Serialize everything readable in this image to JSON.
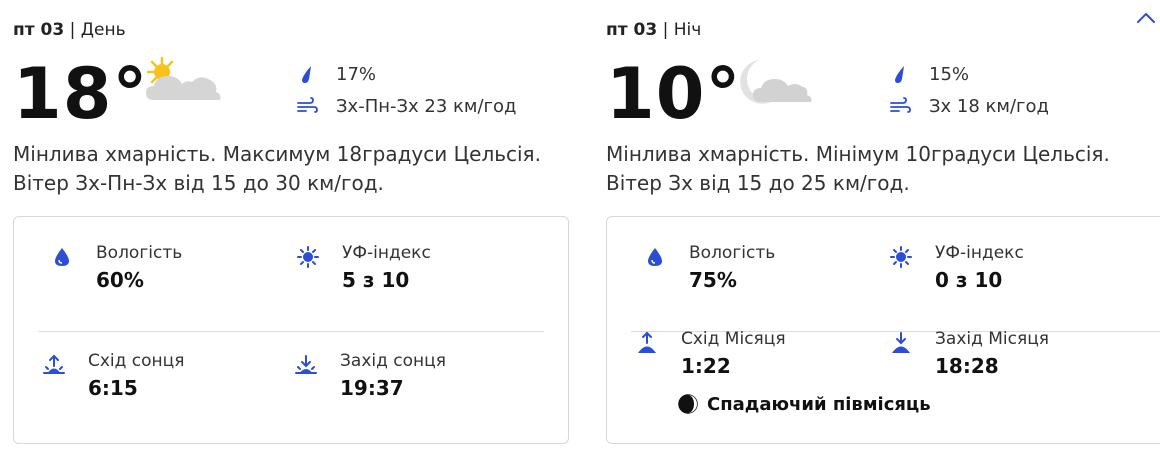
{
  "day": {
    "date": "пт 03",
    "separator": "|",
    "period": "День",
    "temperature": "18°",
    "weather_icon": "partly-sunny-icon",
    "precip": "17%",
    "wind": "Зх-Пн-Зх 23 км/год",
    "description": "Мінлива хмарність. Максимум 18градуси Цельсія. Вітер Зх-Пн-Зх від 15 до 30 км/год.",
    "humidity_label": "Вологість",
    "humidity_value": "60%",
    "uv_label": "УФ-індекс",
    "uv_value": "5 з 10",
    "sunrise_label": "Схід сонця",
    "sunrise_value": "6:15",
    "sunset_label": "Захід сонця",
    "sunset_value": "19:37"
  },
  "night": {
    "date": "пт 03",
    "separator": "|",
    "period": "Ніч",
    "temperature": "10°",
    "weather_icon": "partly-cloudy-night-icon",
    "precip": "15%",
    "wind": "Зх 18 км/год",
    "description": "Мінлива хмарність. Мінімум 10градуси Цельсія. Вітер Зх від 15 до 25 км/год.",
    "humidity_label": "Вологість",
    "humidity_value": "75%",
    "uv_label": "УФ-індекс",
    "uv_value": "0 з 10",
    "moonrise_label": "Схід Місяця",
    "moonrise_value": "1:22",
    "moonset_label": "Захід Місяця",
    "moonset_value": "18:28",
    "moon_phase": "Спадаючий півмісяць"
  },
  "colors": {
    "accent": "#2a4fd6",
    "text": "#1a1a1a",
    "border": "#d8d8d8"
  }
}
